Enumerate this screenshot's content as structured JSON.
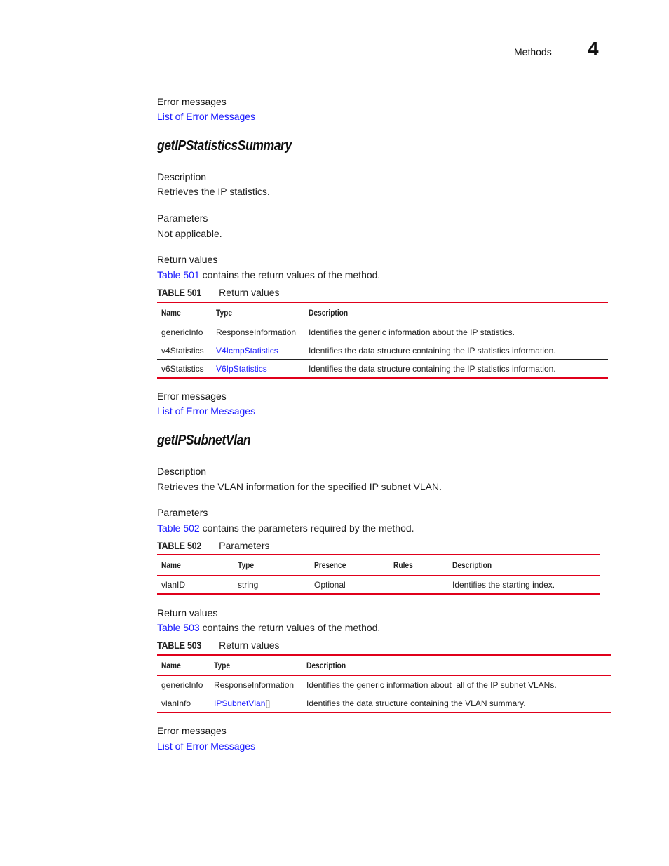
{
  "header": {
    "section_label": "Methods",
    "chapter_number": "4"
  },
  "top_error": {
    "heading": "Error messages",
    "link": "List of Error Messages"
  },
  "method1": {
    "title": "getIPStatisticsSummary",
    "description_heading": "Description",
    "description": "Retrieves the IP statistics.",
    "parameters_heading": "Parameters",
    "parameters_text": "Not applicable.",
    "return_heading": "Return values",
    "return_ref_link": "Table 501",
    "return_ref_text": " contains the return values of the method.",
    "table": {
      "label": "TABLE 501",
      "caption": "Return values",
      "columns": [
        "Name",
        "Type",
        "Description"
      ],
      "rows": [
        {
          "name": "genericInfo",
          "type": "ResponseInformation",
          "type_link": false,
          "description": "Identifies the generic information about the IP statistics."
        },
        {
          "name": "v4Statistics",
          "type": "V4IcmpStatistics",
          "type_link": true,
          "description": "Identifies the data structure containing the IP statistics information."
        },
        {
          "name": "v6Statistics",
          "type": "V6IpStatistics",
          "type_link": true,
          "description": "Identifies the data structure containing the IP statistics information."
        }
      ]
    },
    "error_heading": "Error messages",
    "error_link": "List of Error Messages"
  },
  "method2": {
    "title": "getIPSubnetVlan",
    "description_heading": "Description",
    "description": "Retrieves the VLAN information for the specified IP subnet VLAN.",
    "parameters_heading": "Parameters",
    "params_ref_link": "Table 502",
    "params_ref_text": " contains the parameters required by the method.",
    "params_table": {
      "label": "TABLE 502",
      "caption": "Parameters",
      "columns": [
        "Name",
        "Type",
        "Presence",
        "Rules",
        "Description"
      ],
      "rows": [
        {
          "name": "vlanID",
          "type": "string",
          "presence": "Optional",
          "rules": "",
          "description": "Identifies the starting index."
        }
      ]
    },
    "return_heading": "Return values",
    "return_ref_link": "Table 503",
    "return_ref_text": " contains the return values of the method.",
    "return_table": {
      "label": "TABLE 503",
      "caption": "Return values",
      "columns": [
        "Name",
        "Type",
        "Description"
      ],
      "rows": [
        {
          "name": "genericInfo",
          "type": "ResponseInformation",
          "type_suffix": "",
          "type_link": false,
          "description": "Identifies the generic information about  all of the IP subnet VLANs."
        },
        {
          "name": "vlanInfo",
          "type": "IPSubnetVlan",
          "type_suffix": "[]",
          "type_link": true,
          "description": "Identifies the data structure containing the VLAN summary."
        }
      ]
    },
    "error_heading": "Error messages",
    "error_link": "List of Error Messages"
  }
}
